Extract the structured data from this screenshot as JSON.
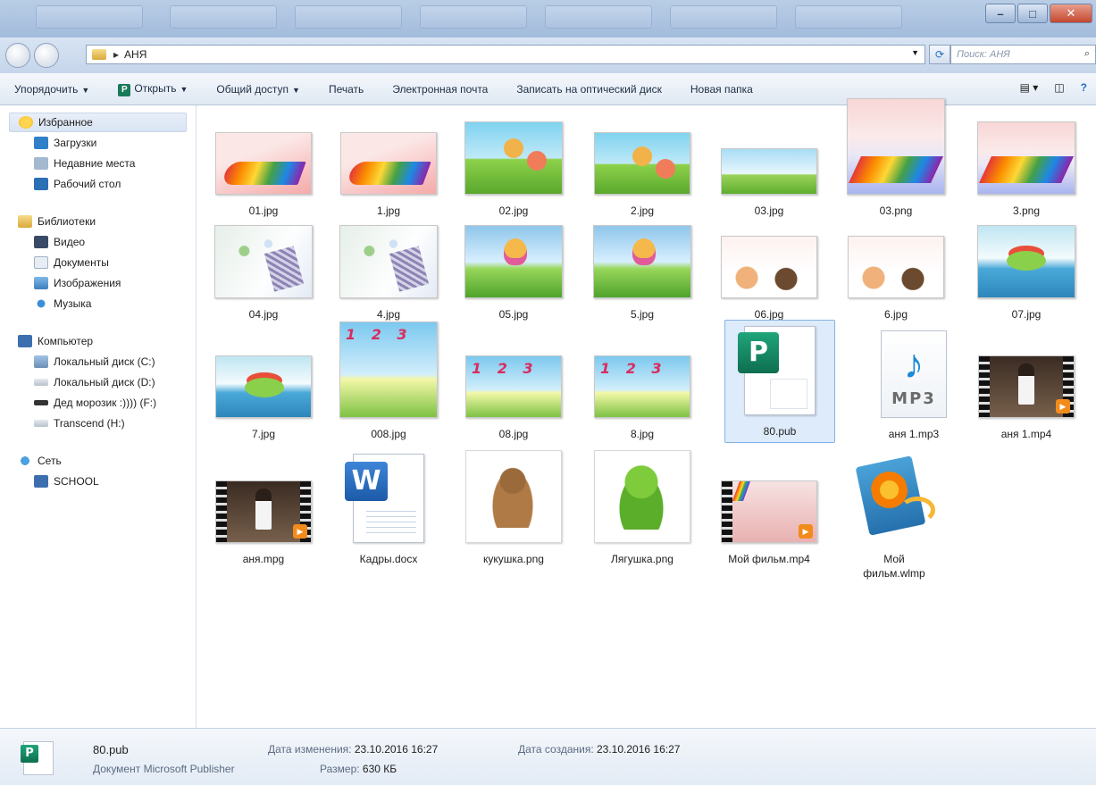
{
  "address": {
    "path": "АНЯ"
  },
  "search": {
    "placeholder": "Поиск: АНЯ"
  },
  "toolbar": {
    "organize": "Упорядочить",
    "open": "Открыть",
    "share": "Общий доступ",
    "print": "Печать",
    "email": "Электронная почта",
    "burn": "Записать на оптический диск",
    "new_folder": "Новая папка"
  },
  "nav": {
    "favorites": {
      "label": "Избранное",
      "items": [
        "Загрузки",
        "Недавние места",
        "Рабочий стол"
      ]
    },
    "libraries": {
      "label": "Библиотеки",
      "items": [
        "Видео",
        "Документы",
        "Изображения",
        "Музыка"
      ]
    },
    "computer": {
      "label": "Компьютер",
      "items": [
        "Локальный диск (C:)",
        "Локальный диск (D:)",
        "Дед морозик :)))) (F:)",
        "Transcend (H:)"
      ]
    },
    "network": {
      "label": "Сеть",
      "items": [
        "SCHOOL"
      ]
    }
  },
  "files": [
    "01.jpg",
    "1.jpg",
    "02.jpg",
    "2.jpg",
    "03.jpg",
    "03.png",
    "3.png",
    "04.jpg",
    "4.jpg",
    "05.jpg",
    "5.jpg",
    "06.jpg",
    "6.jpg",
    "07.jpg",
    "7.jpg",
    "008.jpg",
    "08.jpg",
    "8.jpg",
    "80.pub",
    "аня 1.mp3",
    "аня 1.mp4",
    "аня.mpg",
    "Кадры.docx",
    "кукушка.png",
    "Лягушка.png",
    "Мой фильм.mp4",
    "Мой фильм.wlmp"
  ],
  "selected_file": "80.pub",
  "icons": {
    "mp3_label": "MP3",
    "publisher_letter": "P",
    "word_letter": "W"
  },
  "details": {
    "name": "80.pub",
    "type": "Документ Microsoft Publisher",
    "modified_label": "Дата изменения:",
    "modified_value": "23.10.2016 16:27",
    "created_label": "Дата создания:",
    "created_value": "23.10.2016 16:27",
    "size_label": "Размер:",
    "size_value": "630 КБ"
  }
}
